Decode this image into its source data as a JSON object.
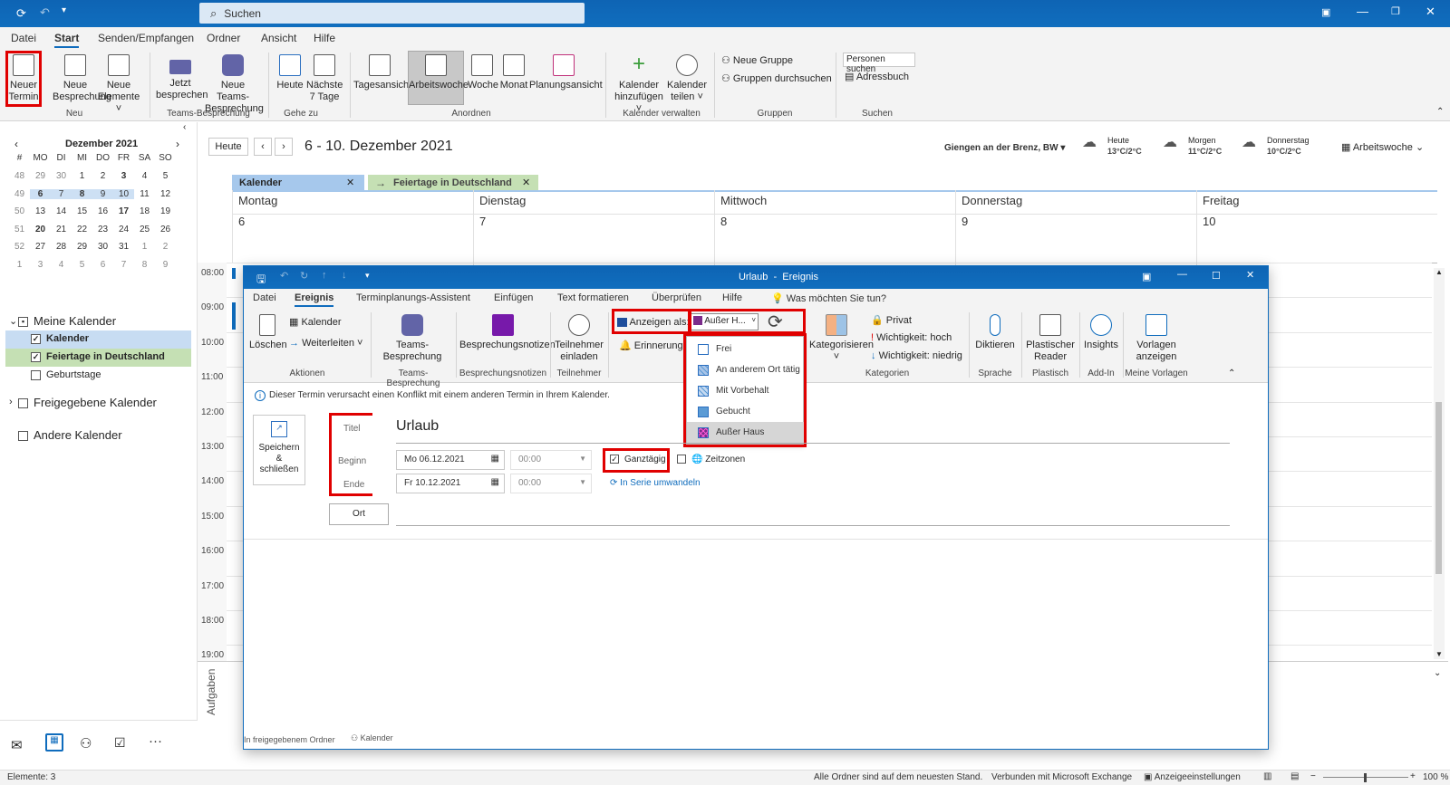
{
  "titlebar": {
    "search_placeholder": "Suchen"
  },
  "menu": {
    "tabs": [
      "Datei",
      "Start",
      "Senden/Empfangen",
      "Ordner",
      "Ansicht",
      "Hilfe"
    ],
    "active": "Start"
  },
  "ribbon": {
    "new_appointment": [
      "Neuer",
      "Termin"
    ],
    "new_meeting": [
      "Neue",
      "Besprechung"
    ],
    "new_items": [
      "Neue",
      "Elemente ˅"
    ],
    "group_new": "Neu",
    "meet_now": [
      "Jetzt",
      "besprechen"
    ],
    "new_teams": [
      "Neue Teams-",
      "Besprechung"
    ],
    "group_teams": "Teams-Besprechung",
    "today": "Heute",
    "next7": [
      "Nächste",
      "7 Tage"
    ],
    "group_goto": "Gehe zu",
    "day_view": "Tagesansicht",
    "work_week": "Arbeitswoche",
    "week": "Woche",
    "month": "Monat",
    "schedule": "Planungsansicht",
    "group_arrange": "Anordnen",
    "add_calendar": [
      "Kalender",
      "hinzufügen ˅"
    ],
    "share_calendar": [
      "Kalender",
      "teilen ˅"
    ],
    "group_manage": "Kalender verwalten",
    "new_group": "Neue Gruppe",
    "browse_groups": "Gruppen durchsuchen",
    "group_groups": "Gruppen",
    "people_search": "Personen suchen",
    "address_book": "Adressbuch",
    "group_find": "Suchen"
  },
  "minical": {
    "title": "Dezember 2021",
    "headers": [
      "#",
      "MO",
      "DI",
      "MI",
      "DO",
      "FR",
      "SA",
      "SO"
    ],
    "rows": [
      [
        "48",
        "29",
        "30",
        "1",
        "2",
        "3",
        "4",
        "5"
      ],
      [
        "49",
        "6",
        "7",
        "8",
        "9",
        "10",
        "11",
        "12"
      ],
      [
        "50",
        "13",
        "14",
        "15",
        "16",
        "17",
        "18",
        "19"
      ],
      [
        "51",
        "20",
        "21",
        "22",
        "23",
        "24",
        "25",
        "26"
      ],
      [
        "52",
        "27",
        "28",
        "29",
        "30",
        "31",
        "1",
        "2"
      ],
      [
        "1",
        "3",
        "4",
        "5",
        "6",
        "7",
        "8",
        "9"
      ]
    ]
  },
  "folders": {
    "my_calendars": "Meine Kalender",
    "calendar": "Kalender",
    "holidays": "Feiertage in Deutschland",
    "birthdays": "Geburtstage",
    "shared": "Freigegebene Kalender",
    "other": "Andere Kalender"
  },
  "calheader": {
    "today_btn": "Heute",
    "range": "6 - 10. Dezember 2021",
    "location": "Giengen an der Brenz, BW",
    "weather": [
      {
        "day": "Heute",
        "temp": "13°C/2°C"
      },
      {
        "day": "Morgen",
        "temp": "11°C/2°C"
      },
      {
        "day": "Donnerstag",
        "temp": "10°C/2°C"
      }
    ],
    "view": "Arbeitswoche"
  },
  "caltabs": {
    "calendar": "Kalender",
    "holidays": "Feiertage in Deutschland"
  },
  "days": [
    {
      "name": "Montag",
      "num": "6"
    },
    {
      "name": "Dienstag",
      "num": "7"
    },
    {
      "name": "Mittwoch",
      "num": "8"
    },
    {
      "name": "Donnerstag",
      "num": "9"
    },
    {
      "name": "Freitag",
      "num": "10"
    }
  ],
  "hours": [
    "08:00",
    "09:00",
    "10:00",
    "11:00",
    "12:00",
    "13:00",
    "14:00",
    "15:00",
    "16:00",
    "17:00",
    "18:00",
    "19:00"
  ],
  "tasks_label": "Aufgaben",
  "status": {
    "items": "Elemente: 3",
    "sync": "Alle Ordner sind auf dem neuesten Stand.",
    "connected": "Verbunden mit Microsoft Exchange",
    "display_settings": "Anzeigeeinstellungen",
    "zoom": "100 %"
  },
  "event": {
    "window_title": "Urlaub  -  Ereignis",
    "tabs": [
      "Datei",
      "Ereignis",
      "Terminplanungs-Assistent",
      "Einfügen",
      "Text formatieren",
      "Überprüfen",
      "Hilfe"
    ],
    "tell_me": "Was möchten Sie tun?",
    "delete": "Löschen",
    "calendar": "Kalender",
    "forward": "Weiterleiten",
    "group_actions": "Aktionen",
    "teams": [
      "Teams-",
      "Besprechung"
    ],
    "group_teams": "Teams-Besprechung",
    "notes": "Besprechungsnotizen",
    "group_notes": "Besprechungsnotizen",
    "invite": [
      "Teilnehmer",
      "einladen"
    ],
    "group_attendees": "Teilnehmer",
    "show_as_label": "Anzeigen als:",
    "show_as_value": "Außer H...",
    "reminder_label": "Erinnerung:",
    "categorize": "Kategorisieren",
    "private": "Privat",
    "high": "Wichtigkeit: hoch",
    "low": "Wichtigkeit: niedrig",
    "group_tags": "Kategorien",
    "dictate": "Diktieren",
    "group_voice": "Sprache",
    "reader": [
      "Plastischer",
      "Reader"
    ],
    "group_reader": "Plastisch",
    "insights": "Insights",
    "group_addin": "Add-In",
    "templates": [
      "Vorlagen",
      "anzeigen"
    ],
    "group_templates": "Meine Vorlagen",
    "dropdown": [
      {
        "label": "Frei",
        "color": "#ffffff"
      },
      {
        "label": "An anderem Ort tätig",
        "color": "#a9c4e8"
      },
      {
        "label": "Mit Vorbehalt",
        "color": "#c5d9f1"
      },
      {
        "label": "Gebucht",
        "color": "#5b9bd5"
      },
      {
        "label": "Außer Haus",
        "color": "#7b2c8b"
      }
    ],
    "conflict": "Dieser Termin verursacht einen Konflikt mit einem anderen Termin in Ihrem Kalender.",
    "save_close": [
      "Speichern",
      "&",
      "schließen"
    ],
    "title_label": "Titel",
    "title_value": "Urlaub",
    "start_label": "Beginn",
    "start_date": "Mo 06.12.2021",
    "start_time": "00:00",
    "end_label": "Ende",
    "end_date": "Fr 10.12.2021",
    "end_time": "00:00",
    "allday": "Ganztägig",
    "timezones": "Zeitzonen",
    "recurring": "In Serie umwandeln",
    "location_btn": "Ort",
    "footer_shared": "In freigegebenem Ordner",
    "footer_calendar": "Kalender"
  }
}
